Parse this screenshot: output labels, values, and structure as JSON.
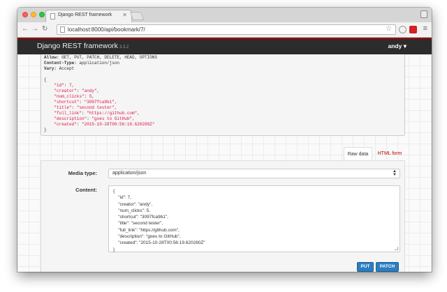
{
  "browser": {
    "tab_title": "Django REST framework",
    "url": "localhost:8000/api/bookmark/7/"
  },
  "navbar": {
    "brand": "Django REST framework",
    "version": "3.3.2",
    "user": "andy"
  },
  "response": {
    "headers": [
      {
        "name": "Allow:",
        "value": "GET, PUT, PATCH, DELETE, HEAD, OPTIONS"
      },
      {
        "name": "Content-Type:",
        "value": "application/json"
      },
      {
        "name": "Vary:",
        "value": "Accept"
      }
    ],
    "body": [
      {
        "key": "\"id\"",
        "value": "7,"
      },
      {
        "key": "\"creator\"",
        "value": "\"andy\","
      },
      {
        "key": "\"num_clicks\"",
        "value": "5,"
      },
      {
        "key": "\"shortcut\"",
        "value": "\"3097fca9b1\","
      },
      {
        "key": "\"title\"",
        "value": "\"second tester\","
      },
      {
        "key": "\"full_link\"",
        "value": "\"https://github.com\","
      },
      {
        "key": "\"description\"",
        "value": "\"goes to GitHub\","
      },
      {
        "key": "\"created\"",
        "value": "\"2015-10-28T00:56:19.620280Z\""
      }
    ]
  },
  "tabs": {
    "raw": "Raw data",
    "html": "HTML form"
  },
  "form": {
    "media_type_label": "Media type:",
    "media_type_value": "application/json",
    "content_label": "Content:",
    "content_lines": [
      "{",
      "    \"id\": 7,",
      "    \"creator\": \"andy\",",
      "    \"num_clicks\": 5,",
      "    \"shortcut\": \"3097fca9b1\",",
      "    \"title\": \"second tester\",",
      "    \"full_link\": \"https://github.com\",",
      "    \"description\": \"goes to GitHub\",",
      "    \"created\": \"2015-10-28T00:56:19.620280Z\"",
      "}"
    ],
    "put_label": "PUT",
    "patch_label": "PATCH"
  },
  "colors": {
    "accent": "#2c7ec2",
    "navbar": "#2c2c2c",
    "brand_line": "#a30000",
    "string": "#dd1144"
  }
}
